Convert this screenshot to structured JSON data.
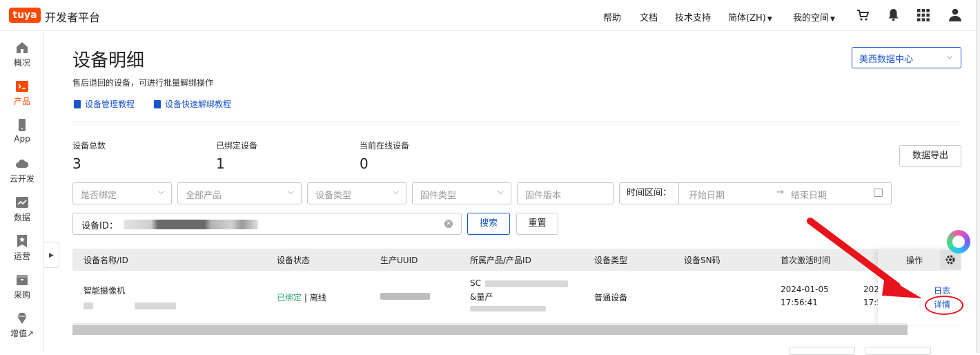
{
  "header": {
    "logo_badge": "tuya",
    "logo_text": "开发者平台",
    "nav": {
      "help": "帮助",
      "docs": "文档",
      "support": "技术支持",
      "language": "简体(ZH)",
      "my_space": "我的空间"
    },
    "icons": [
      "cart-icon",
      "bell-icon",
      "apps-grid-icon",
      "user-icon"
    ]
  },
  "sidebar": {
    "items": [
      {
        "label": "概况",
        "icon": "home-icon"
      },
      {
        "label": "产品",
        "icon": "terminal-icon",
        "active": true
      },
      {
        "label": "App",
        "icon": "phone-icon"
      },
      {
        "label": "云开发",
        "icon": "cloud-icon"
      },
      {
        "label": "数据",
        "icon": "chart-icon"
      },
      {
        "label": "运营",
        "icon": "bookmark-star-icon"
      },
      {
        "label": "采购",
        "icon": "box-icon"
      },
      {
        "label": "增值↗",
        "icon": "diamond-icon"
      }
    ]
  },
  "main": {
    "title": "设备明细",
    "subtitle": "售后退回的设备，可进行批量解绑操作",
    "links": [
      "设备管理教程",
      "设备快速解绑教程"
    ],
    "region": "美西数据中心",
    "stats": [
      {
        "label": "设备总数",
        "value": "3"
      },
      {
        "label": "已绑定设备",
        "value": "1"
      },
      {
        "label": "当前在线设备",
        "value": "0"
      }
    ],
    "export_label": "数据导出",
    "filters": {
      "bound": "是否绑定",
      "product": "全部产品",
      "device_type": "设备类型",
      "firmware_type": "固件类型",
      "firmware_version": "固件版本",
      "time_label": "时间区间：",
      "start_date": "开始日期",
      "end_date": "结束日期",
      "device_id_label": "设备ID："
    },
    "search_label": "搜索",
    "reset_label": "重置"
  },
  "table": {
    "columns": [
      "设备名称/ID",
      "设备状态",
      "生产UUID",
      "所属产品/产品ID",
      "设备类型",
      "设备SN码",
      "首次激活时间",
      "操作"
    ],
    "rows": [
      {
        "name": "智能摄像机",
        "status_bound": "已绑定",
        "status_sep": " | ",
        "status_online": "离线",
        "product_line1": "SC",
        "product_line2": "&量产",
        "device_type": "普通设备",
        "first_active_date": "2024-01-05",
        "first_active_time": "17:56:41",
        "next_col_date": "202",
        "next_col_time": "17:5",
        "actions": [
          "日志",
          "详情"
        ]
      }
    ]
  },
  "colors": {
    "brand": "#ff4800",
    "link": "#1a55c8",
    "bound_green": "#2ba471",
    "annotation_red": "#e8141b"
  }
}
